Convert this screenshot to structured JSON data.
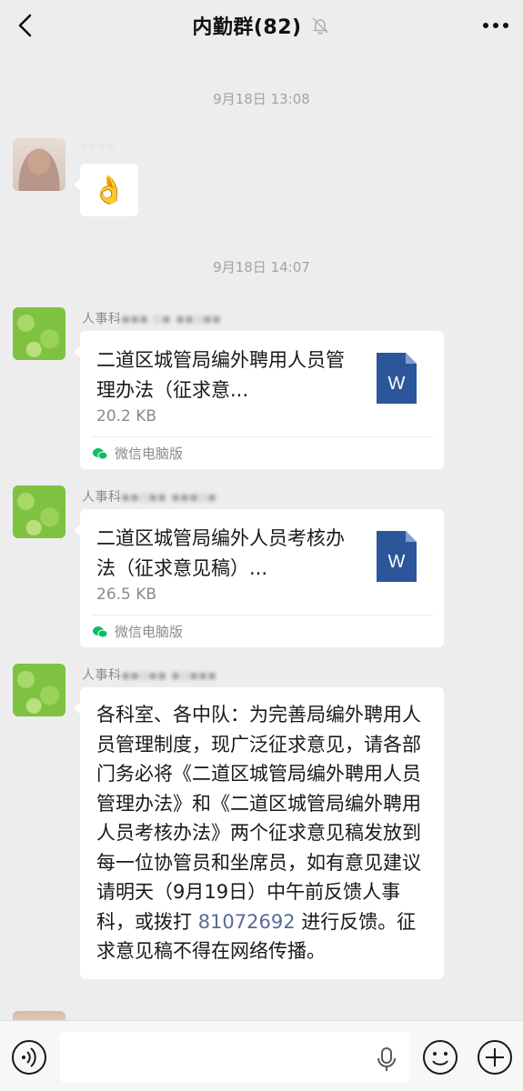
{
  "header": {
    "title": "内勤群(82)",
    "back_icon": "chevron-left-icon",
    "mute_icon": "bell-off-icon",
    "more_icon": "more-horizontal-icon"
  },
  "messages": [
    {
      "type": "timestamp",
      "text": "9月18日 13:08"
    },
    {
      "type": "emoji",
      "sender": "",
      "emoji": "👌"
    },
    {
      "type": "timestamp",
      "text": "9月18日 14:07"
    },
    {
      "type": "file",
      "sender_prefix": "人事科",
      "title": "二道区城管局编外聘用人员管理办法（征求意...",
      "size": "20.2 KB",
      "file_type": "W",
      "source": "微信电脑版"
    },
    {
      "type": "file",
      "sender_prefix": "人事科",
      "title": "二道区城管局编外人员考核办法（征求意见稿）...",
      "size": "26.5 KB",
      "file_type": "W",
      "source": "微信电脑版"
    },
    {
      "type": "text",
      "sender_prefix": "人事科",
      "text_before_link": "各科室、各中队：为完善局编外聘用人员管理制度，现广泛征求意见，请各部门务必将《二道区城管局编外聘用人员管理办法》和《二道区城管局编外聘用人员考核办法》两个征求意见稿发放到每一位协管员和坐席员，如有意见建议请明天（9月19日）中午前反馈人事科，或拨打",
      "link": "81072692",
      "text_after_link": "进行反馈。征求意见稿不得在网络传播。"
    }
  ],
  "input": {
    "value": "",
    "voice_icon": "voice-icon",
    "mic_icon": "mic-icon",
    "emoji_icon": "smiley-icon",
    "plus_icon": "plus-circle-icon"
  },
  "colors": {
    "background": "#ededed",
    "bubble": "#ffffff",
    "word_icon": "#2b579a",
    "link": "#576b95",
    "wechat_green": "#07c160"
  }
}
